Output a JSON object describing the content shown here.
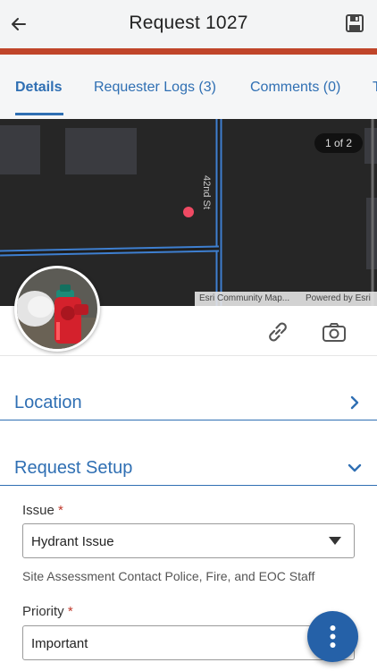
{
  "header": {
    "title": "Request 1027",
    "back_icon": "arrow-left-icon",
    "save_icon": "save-icon"
  },
  "tabs": [
    {
      "label": "Details",
      "active": true
    },
    {
      "label": "Requester Logs (3)",
      "active": false
    },
    {
      "label": "Comments (0)",
      "active": false
    },
    {
      "label": "T",
      "active": false
    }
  ],
  "map": {
    "street_label": "42nd St",
    "counter": "1 of 2",
    "attribution_left": "Esri Community Map...",
    "attribution_right": "Powered by Esri"
  },
  "actions": {
    "link_icon": "link-icon",
    "camera_icon": "camera-icon"
  },
  "sections": {
    "location": {
      "title": "Location",
      "expanded": false
    },
    "request_setup": {
      "title": "Request Setup",
      "expanded": true
    }
  },
  "fields": {
    "issue": {
      "label": "Issue",
      "required_mark": "*",
      "value": "Hydrant Issue"
    },
    "issue_hint": "Site Assessment Contact Police, Fire, and EOC Staff",
    "priority": {
      "label": "Priority",
      "required_mark": "*",
      "value": "Important"
    }
  },
  "fab": {
    "icon": "more-vertical-icon"
  },
  "colors": {
    "accent": "#2f6fb3",
    "header_bar": "#c0452a",
    "fab": "#2561a8",
    "required": "#c0392b"
  }
}
